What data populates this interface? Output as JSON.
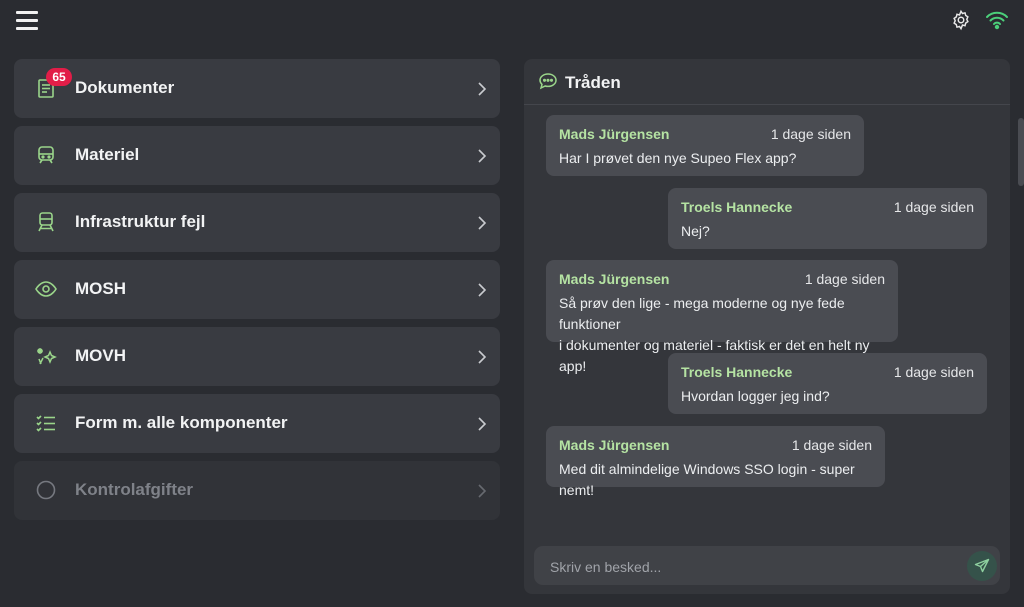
{
  "topbar": {
    "menu_icon": "hamburger-menu-icon",
    "settings_icon": "gear-icon",
    "connection_icon": "wifi-icon",
    "connection_color": "#4bd07a"
  },
  "menu": {
    "items": [
      {
        "label": "Dokumenter",
        "icon": "document-icon",
        "badge": "65",
        "enabled": true
      },
      {
        "label": "Materiel",
        "icon": "train-icon",
        "enabled": true
      },
      {
        "label": "Infrastruktur fejl",
        "icon": "train-track-icon",
        "enabled": true
      },
      {
        "label": "MOSH",
        "icon": "eye-icon",
        "enabled": true
      },
      {
        "label": "MOVH",
        "icon": "sparkle-icon",
        "enabled": true
      },
      {
        "label": "Form m. alle komponenter",
        "icon": "checklist-icon",
        "enabled": true
      },
      {
        "label": "Kontrolafgifter",
        "icon": "circle-icon",
        "enabled": false
      }
    ]
  },
  "thread": {
    "title": "Tråden",
    "icon": "chat-bubble-icon",
    "messages": [
      {
        "author": "Mads Jürgensen",
        "time": "1 dage siden",
        "lines": [
          "Har I prøvet den nye Supeo Flex app?"
        ]
      },
      {
        "author": "Troels Hannecke",
        "time": "1 dage siden",
        "lines": [
          "Nej?"
        ]
      },
      {
        "author": "Mads Jürgensen",
        "time": "1 dage siden",
        "lines": [
          "Så prøv den lige - mega moderne og nye fede funktioner",
          "i dokumenter og materiel - faktisk er det en helt ny app!"
        ]
      },
      {
        "author": "Troels Hannecke",
        "time": "1 dage siden",
        "lines": [
          "Hvordan logger jeg ind?"
        ]
      },
      {
        "author": "Mads Jürgensen",
        "time": "1 dage siden",
        "lines": [
          "Med dit almindelige Windows SSO login - super nemt!"
        ]
      }
    ],
    "composer": {
      "placeholder": "Skriv en besked...",
      "value": "",
      "send_icon": "send-icon"
    }
  },
  "colors": {
    "background": "#2a2c31",
    "card": "#393b41",
    "author": "#b5e3a3",
    "badge": "#e21d48",
    "accent": "#9ad58a"
  }
}
